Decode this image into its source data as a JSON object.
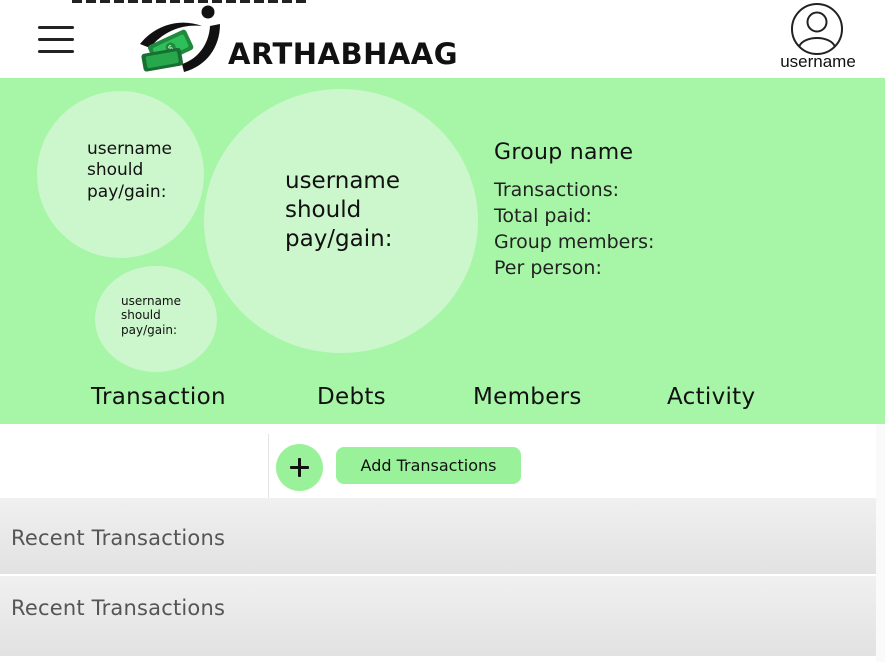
{
  "app": {
    "brand": "ARTHABHAAG",
    "username": "username",
    "colors": {
      "accent": "#a7f6a7",
      "bubble": "#ccf6cc",
      "button": "#99f299"
    }
  },
  "header": {
    "menu_icon": "hamburger-icon",
    "logo_icon": "money-person-logo",
    "profile_icon": "user-circle-icon"
  },
  "bubbles": [
    {
      "text": "username should pay/gain:"
    },
    {
      "text": "username should pay/gain:"
    },
    {
      "text": "username should pay/gain:"
    }
  ],
  "group": {
    "name": "Group name",
    "transactions_label": "Transactions:",
    "total_paid_label": "Total paid:",
    "members_label": "Group members:",
    "per_person_label": "Per person:"
  },
  "tabs": [
    {
      "label": "Transaction"
    },
    {
      "label": "Debts"
    },
    {
      "label": "Members"
    },
    {
      "label": "Activity"
    }
  ],
  "actions": {
    "add_icon": "plus-icon",
    "add_label": "Add Transactions"
  },
  "recent": [
    {
      "label": "Recent Transactions"
    },
    {
      "label": "Recent Transactions"
    }
  ]
}
